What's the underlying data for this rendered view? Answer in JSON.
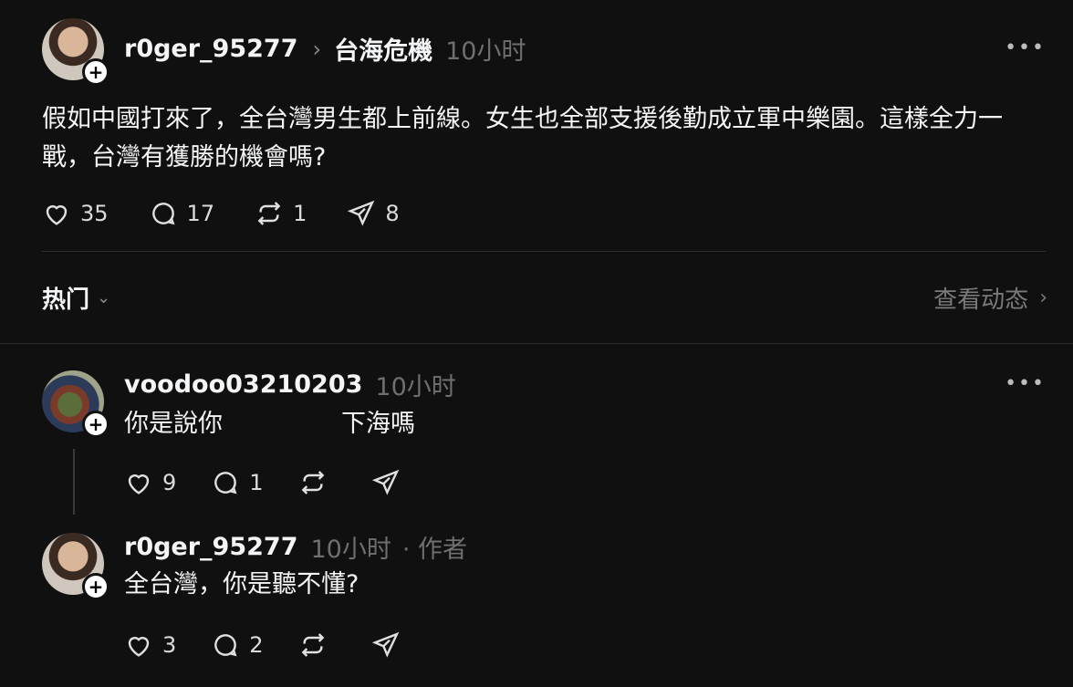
{
  "post": {
    "username": "r0ger_95277",
    "topic": "台海危機",
    "time": "10小时",
    "text_line1": "假如中國打來了，全台灣男生都上前線。女生也全部支援後勤成立軍中樂園。這樣全力一",
    "text_line2": "戰，台灣有獲勝的機會嗎?",
    "likes": "35",
    "comments": "17",
    "reposts": "1",
    "shares": "8"
  },
  "sort": {
    "label": "热门",
    "activity_label": "查看动态"
  },
  "replies": [
    {
      "username": "voodoo03210203",
      "time": "10小时",
      "text_start": "你是說你",
      "text_end": "下海嗎",
      "likes": "9",
      "comments": "1"
    },
    {
      "username": "r0ger_95277",
      "time": "10小时",
      "author_tag": "· 作者",
      "text": "全台灣，你是聽不懂?",
      "likes": "3",
      "comments": "2"
    }
  ],
  "icons": {
    "more": "more-icon",
    "like": "heart-icon",
    "comment": "comment-icon",
    "repost": "repost-icon",
    "share": "share-icon",
    "follow": "plus-icon"
  },
  "colors": {
    "background": "#101010",
    "text": "#f3f5f7",
    "muted": "#6f6f6f"
  }
}
